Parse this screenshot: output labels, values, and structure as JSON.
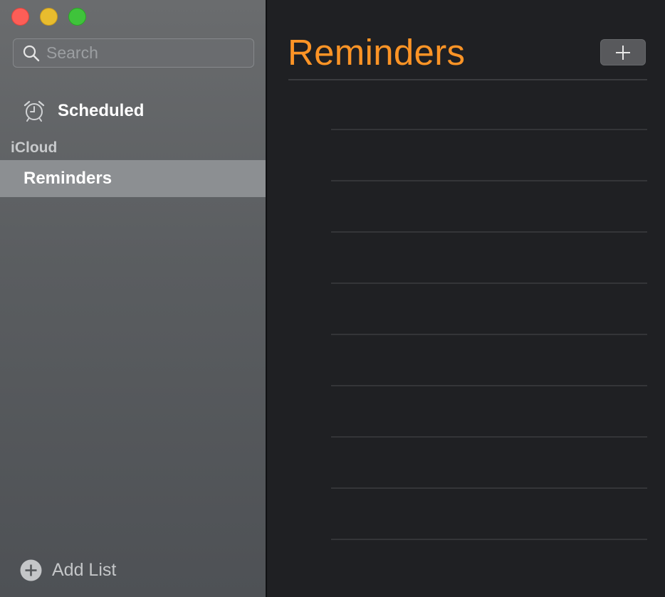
{
  "sidebar": {
    "search": {
      "placeholder": "Search",
      "value": ""
    },
    "smart_lists": [
      {
        "label": "Scheduled",
        "icon": "alarm-clock-icon"
      }
    ],
    "section_header": "iCloud",
    "lists": [
      {
        "label": "Reminders",
        "selected": true
      }
    ],
    "add_list_label": "Add List"
  },
  "main": {
    "title": "Reminders",
    "add_button_icon": "plus-icon",
    "empty_rows": 9
  },
  "colors": {
    "accent": "#fd9426",
    "close": "#fd5e57",
    "minimize": "#e8bc2e",
    "maximize": "#3fc33b"
  }
}
